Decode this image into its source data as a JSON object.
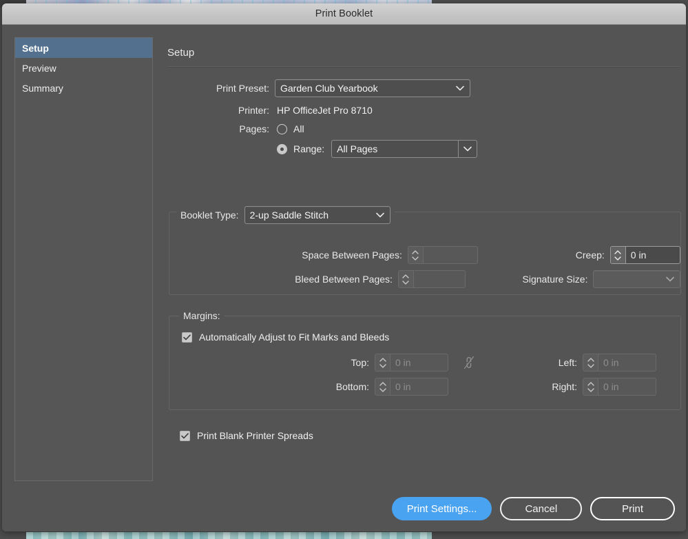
{
  "window": {
    "title": "Print Booklet"
  },
  "sidebar": {
    "items": [
      {
        "label": "Setup",
        "selected": true
      },
      {
        "label": "Preview",
        "selected": false
      },
      {
        "label": "Summary",
        "selected": false
      }
    ]
  },
  "main": {
    "panel_title": "Setup",
    "print_preset": {
      "label": "Print Preset:",
      "value": "Garden Club Yearbook"
    },
    "printer": {
      "label": "Printer:",
      "value": "HP OfficeJet Pro 8710"
    },
    "pages": {
      "label": "Pages:",
      "all_label": "All",
      "all_selected": false,
      "range_label": "Range:",
      "range_selected": true,
      "range_value": "All Pages"
    },
    "booklet": {
      "legend": "Booklet Type:",
      "type_value": "2-up Saddle Stitch",
      "space_between_label": "Space Between Pages:",
      "space_between_value": "",
      "bleed_between_label": "Bleed Between Pages:",
      "bleed_between_value": "",
      "creep_label": "Creep:",
      "creep_value": "0 in",
      "signature_label": "Signature Size:",
      "signature_value": ""
    },
    "margins": {
      "legend": "Margins:",
      "auto_adjust_label": "Automatically Adjust to Fit Marks and Bleeds",
      "auto_adjust_checked": true,
      "top_label": "Top:",
      "top_value": "0 in",
      "bottom_label": "Bottom:",
      "bottom_value": "0 in",
      "left_label": "Left:",
      "left_value": "0 in",
      "right_label": "Right:",
      "right_value": "0 in",
      "link_icon": "broken-chain-link-icon"
    },
    "blank_spreads": {
      "label": "Print Blank Printer Spreads",
      "checked": true
    }
  },
  "footer": {
    "print_settings_label": "Print Settings...",
    "cancel_label": "Cancel",
    "print_label": "Print"
  },
  "colors": {
    "accent_blue": "#4aa3f0",
    "selection_blue": "#53718f",
    "dialog_bg": "#545454",
    "titlebar": "#c6c6c6"
  }
}
